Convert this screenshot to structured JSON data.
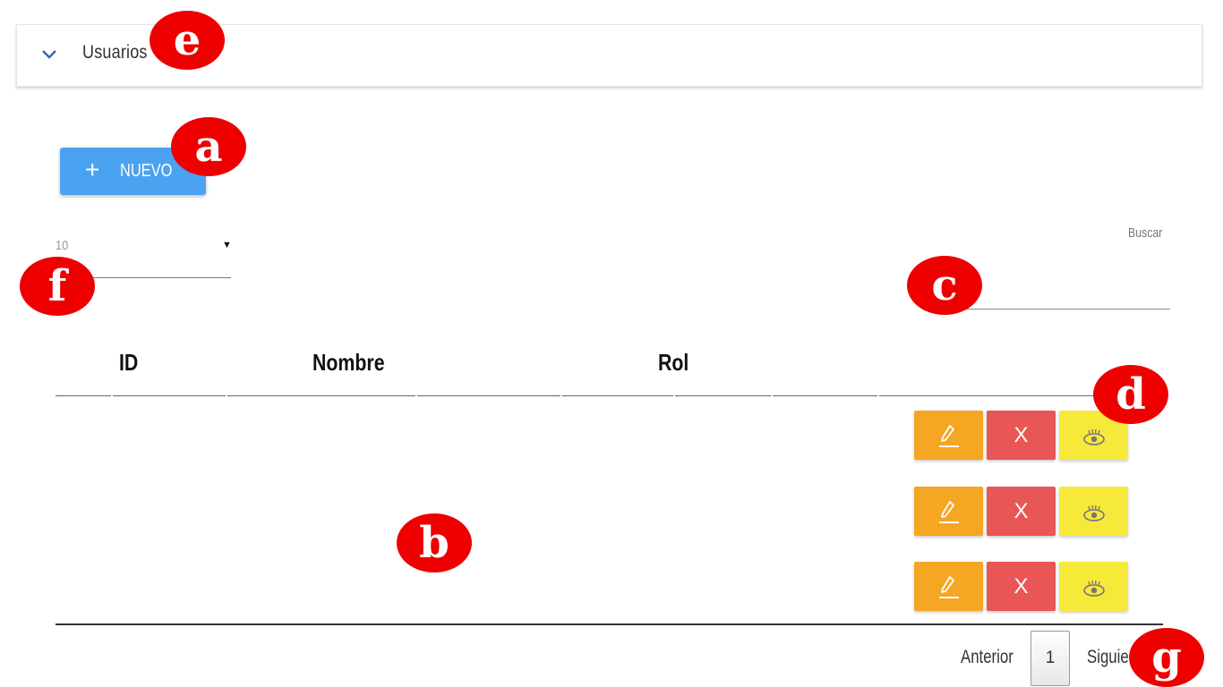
{
  "panel": {
    "title": "Usuarios",
    "icon": "chevron-down-icon"
  },
  "toolbar": {
    "new_label": "NUEVO",
    "new_icon": "plus-icon"
  },
  "length_select": {
    "value": "10"
  },
  "search": {
    "label": "Buscar",
    "value": ""
  },
  "table": {
    "columns": [
      "ID",
      "Nombre",
      "Rol"
    ],
    "rows": [
      {
        "id": "",
        "nombre": "",
        "rol": "",
        "actions": {
          "delete_label": "X"
        }
      },
      {
        "id": "",
        "nombre": "",
        "rol": "",
        "actions": {
          "delete_label": "X"
        }
      },
      {
        "id": "",
        "nombre": "",
        "rol": "",
        "actions": {
          "delete_label": "X"
        }
      }
    ]
  },
  "pagination": {
    "prev_label": "Anterior",
    "current_page": "1",
    "next_label": "Siguiente"
  },
  "markers": {
    "a": "a",
    "b": "b",
    "c": "c",
    "d": "d",
    "e": "e",
    "f": "f",
    "g": "g"
  },
  "colors": {
    "primary": "#4aa3f0",
    "edit": "#f5a623",
    "delete": "#e85656",
    "view": "#f7e93a",
    "marker": "#ee0000"
  }
}
